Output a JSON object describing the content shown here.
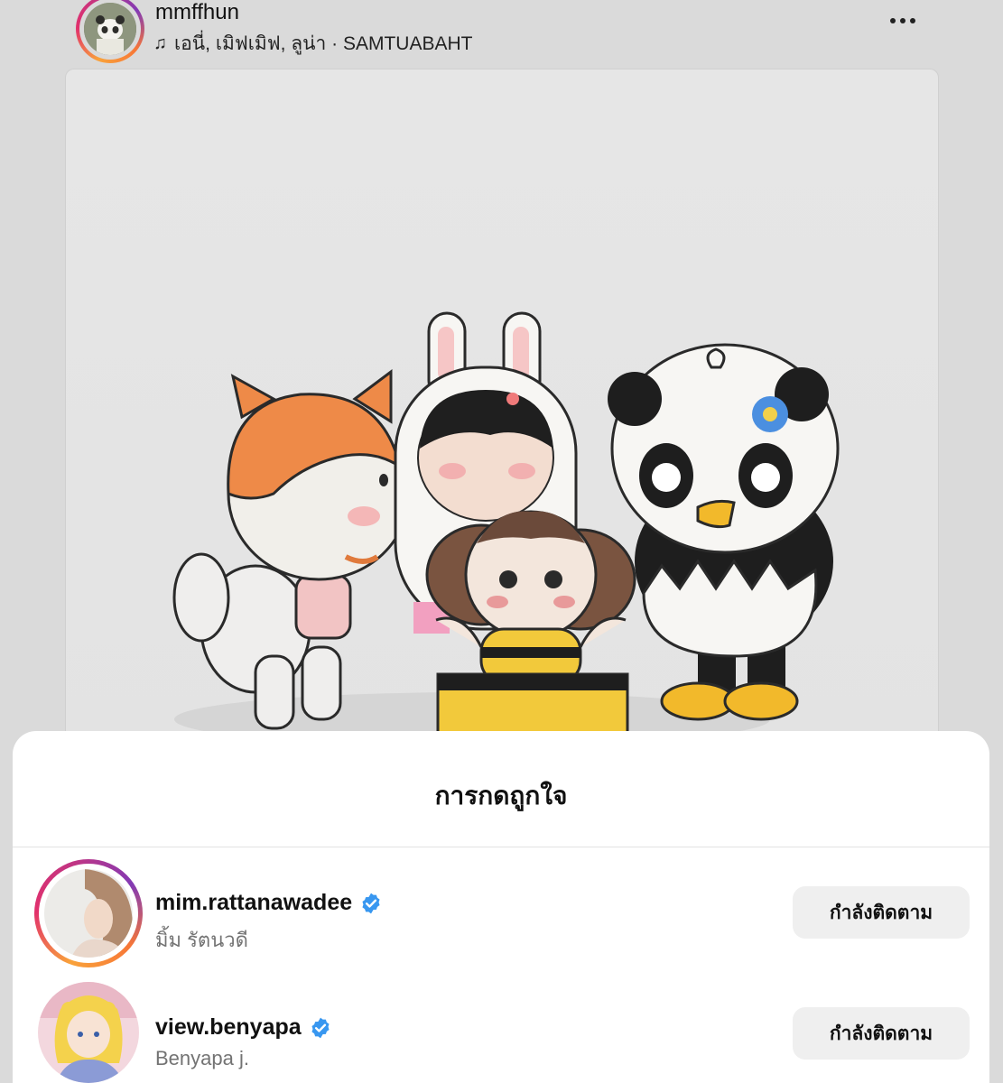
{
  "post": {
    "username": "mmffhun",
    "music": "เอนี่, เมิฟเมิฟ, ลูน่า · SAMTUABAHT",
    "music_icon": "music-note-icon",
    "more_icon": "more-options-icon"
  },
  "likes_sheet": {
    "title": "การกดถูกใจ",
    "users": [
      {
        "username": "mim.rattanawadee",
        "full_name": "มิ้ม รัตนวดี",
        "verified": true,
        "has_story": true,
        "button_label": "กำลังติดตาม"
      },
      {
        "username": "view.benyapa",
        "full_name": "Benyapa j.",
        "verified": true,
        "has_story": false,
        "button_label": "กำลังติดตาม"
      }
    ]
  },
  "colors": {
    "verified": "#3897f0",
    "button_bg": "#efefef",
    "secondary_text": "#737373"
  }
}
